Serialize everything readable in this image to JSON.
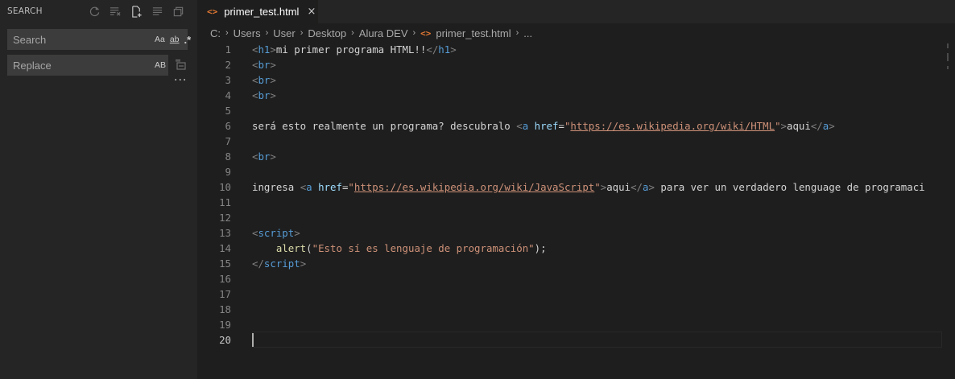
{
  "sidebar": {
    "title": "SEARCH",
    "actions": [
      "refresh-icon",
      "clear-results-icon",
      "new-search-editor-icon",
      "collapse-all-icon",
      "view-as-tree-icon"
    ],
    "search": {
      "placeholder": "Search",
      "value": "",
      "options": [
        "Aa",
        "ab",
        ".*"
      ]
    },
    "replace": {
      "placeholder": "Replace",
      "value": "",
      "options": [
        "AB"
      ]
    },
    "more": "···"
  },
  "tab": {
    "label": "primer_test.html",
    "icon": "<>",
    "close": "×"
  },
  "breadcrumb": [
    "C:",
    "Users",
    "User",
    "Desktop",
    "Alura DEV",
    "primer_test.html",
    "..."
  ],
  "editor": {
    "lines": [
      {
        "n": "1",
        "t": [
          [
            "ang",
            "<"
          ],
          [
            "tag",
            "h1"
          ],
          [
            "ang",
            ">"
          ],
          [
            "txt",
            "mi primer programa HTML!!"
          ],
          [
            "ang",
            "</"
          ],
          [
            "tag",
            "h1"
          ],
          [
            "ang",
            ">"
          ]
        ]
      },
      {
        "n": "2",
        "t": [
          [
            "ang",
            "<"
          ],
          [
            "tag",
            "br"
          ],
          [
            "ang",
            ">"
          ]
        ]
      },
      {
        "n": "3",
        "t": [
          [
            "ang",
            "<"
          ],
          [
            "tag",
            "br"
          ],
          [
            "ang",
            ">"
          ]
        ]
      },
      {
        "n": "4",
        "t": [
          [
            "ang",
            "<"
          ],
          [
            "tag",
            "br"
          ],
          [
            "ang",
            ">"
          ]
        ]
      },
      {
        "n": "5",
        "t": []
      },
      {
        "n": "6",
        "t": [
          [
            "txt",
            "será esto realmente un programa? descubralo "
          ],
          [
            "ang",
            "<"
          ],
          [
            "tag",
            "a"
          ],
          [
            "txt",
            " "
          ],
          [
            "attr",
            "href"
          ],
          [
            "txt",
            "="
          ],
          [
            "str",
            "\""
          ],
          [
            "link",
            "https://es.wikipedia.org/wiki/HTML"
          ],
          [
            "str",
            "\""
          ],
          [
            "ang",
            ">"
          ],
          [
            "txt",
            "aqui"
          ],
          [
            "ang",
            "</"
          ],
          [
            "tag",
            "a"
          ],
          [
            "ang",
            ">"
          ]
        ]
      },
      {
        "n": "7",
        "t": []
      },
      {
        "n": "8",
        "t": [
          [
            "ang",
            "<"
          ],
          [
            "tag",
            "br"
          ],
          [
            "ang",
            ">"
          ]
        ]
      },
      {
        "n": "9",
        "t": []
      },
      {
        "n": "10",
        "t": [
          [
            "txt",
            "ingresa "
          ],
          [
            "ang",
            "<"
          ],
          [
            "tag",
            "a"
          ],
          [
            "txt",
            " "
          ],
          [
            "attr",
            "href"
          ],
          [
            "txt",
            "="
          ],
          [
            "str",
            "\""
          ],
          [
            "link",
            "https://es.wikipedia.org/wiki/JavaScript"
          ],
          [
            "str",
            "\""
          ],
          [
            "ang",
            ">"
          ],
          [
            "txt",
            "aqui"
          ],
          [
            "ang",
            "</"
          ],
          [
            "tag",
            "a"
          ],
          [
            "ang",
            ">"
          ],
          [
            "txt",
            " para ver un verdadero lenguage de programaci"
          ]
        ]
      },
      {
        "n": "11",
        "t": []
      },
      {
        "n": "12",
        "t": []
      },
      {
        "n": "13",
        "t": [
          [
            "ang",
            "<"
          ],
          [
            "tag",
            "script"
          ],
          [
            "ang",
            ">"
          ]
        ]
      },
      {
        "n": "14",
        "t": [
          [
            "txt",
            "    "
          ],
          [
            "fn",
            "alert"
          ],
          [
            "txt",
            "("
          ],
          [
            "str",
            "\"Esto sí es lenguaje de programación\""
          ],
          [
            "txt",
            ");"
          ]
        ]
      },
      {
        "n": "15",
        "t": [
          [
            "ang",
            "</"
          ],
          [
            "tag",
            "script"
          ],
          [
            "ang",
            ">"
          ]
        ]
      },
      {
        "n": "16",
        "t": []
      },
      {
        "n": "17",
        "t": []
      },
      {
        "n": "18",
        "t": []
      },
      {
        "n": "19",
        "t": []
      },
      {
        "n": "20",
        "t": []
      }
    ],
    "active_line": "20"
  },
  "colors": {
    "keyword": "#569cd6",
    "attribute": "#9cdcfe",
    "string": "#ce9178",
    "function": "#dcdcaa",
    "html_icon": "#e37933"
  }
}
